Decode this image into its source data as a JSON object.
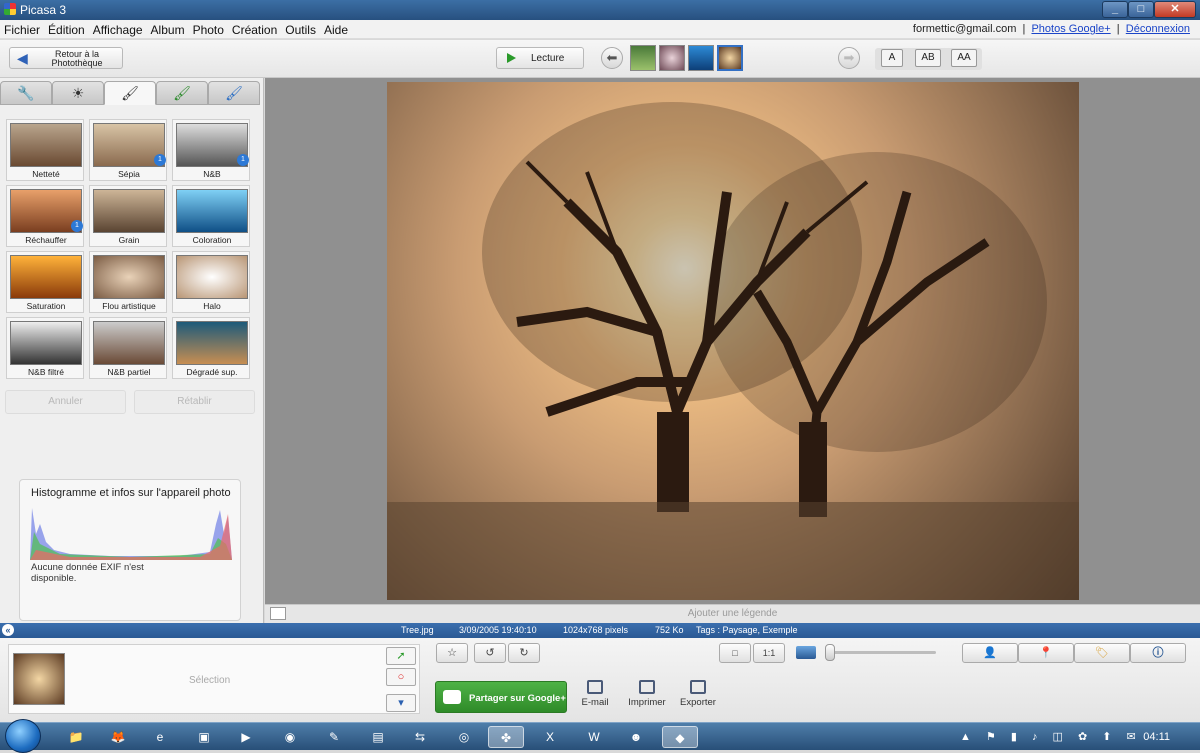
{
  "window": {
    "title": "Picasa 3",
    "minimize": "_",
    "maximize": "□",
    "close": "✕"
  },
  "menu": {
    "items": [
      "Fichier",
      "Édition",
      "Affichage",
      "Album",
      "Photo",
      "Création",
      "Outils",
      "Aide"
    ],
    "account": "formettic@gmail.com",
    "sep": "|",
    "photos_link": "Photos Google+",
    "logout_link": "Déconnexion"
  },
  "toolbar": {
    "back_label": "Retour à la Photothèque",
    "play_label": "Lecture",
    "text_buttons": [
      "A",
      "AB",
      "AA"
    ]
  },
  "left_panel": {
    "tab_icons": [
      "wrench-icon",
      "sun-icon",
      "brush-icon",
      "green-brush-icon",
      "blue-brush-icon"
    ],
    "effects": [
      {
        "label": "Netteté",
        "badge": ""
      },
      {
        "label": "Sépia",
        "badge": "1"
      },
      {
        "label": "N&B",
        "badge": "1"
      },
      {
        "label": "Réchauffer",
        "badge": "1"
      },
      {
        "label": "Grain",
        "badge": ""
      },
      {
        "label": "Coloration",
        "badge": ""
      },
      {
        "label": "Saturation",
        "badge": ""
      },
      {
        "label": "Flou artistique",
        "badge": ""
      },
      {
        "label": "Halo",
        "badge": ""
      },
      {
        "label": "N&B filtré",
        "badge": ""
      },
      {
        "label": "N&B partiel",
        "badge": ""
      },
      {
        "label": "Dégradé sup.",
        "badge": ""
      }
    ],
    "undo_label": "Annuler",
    "redo_label": "Rétablir",
    "histogram_title": "Histogramme et infos sur l'appareil photo",
    "exif_text": "Aucune donnée EXIF n'est disponible."
  },
  "photo": {
    "caption_placeholder": "Ajouter une légende"
  },
  "infobar": {
    "filename": "Tree.jpg",
    "date": "3/09/2005 19:40:10",
    "dimensions": "1024x768 pixels",
    "size": "752 Ko",
    "tags": "Tags : Paysage, Exemple"
  },
  "tray": {
    "selection_label": "Sélection",
    "size_buttons": [
      "□",
      "1:1"
    ],
    "share_label": "Partager sur Google+",
    "actions": [
      "E-mail",
      "Imprimer",
      "Exporter"
    ]
  },
  "taskbar": {
    "clock": "04:11"
  }
}
